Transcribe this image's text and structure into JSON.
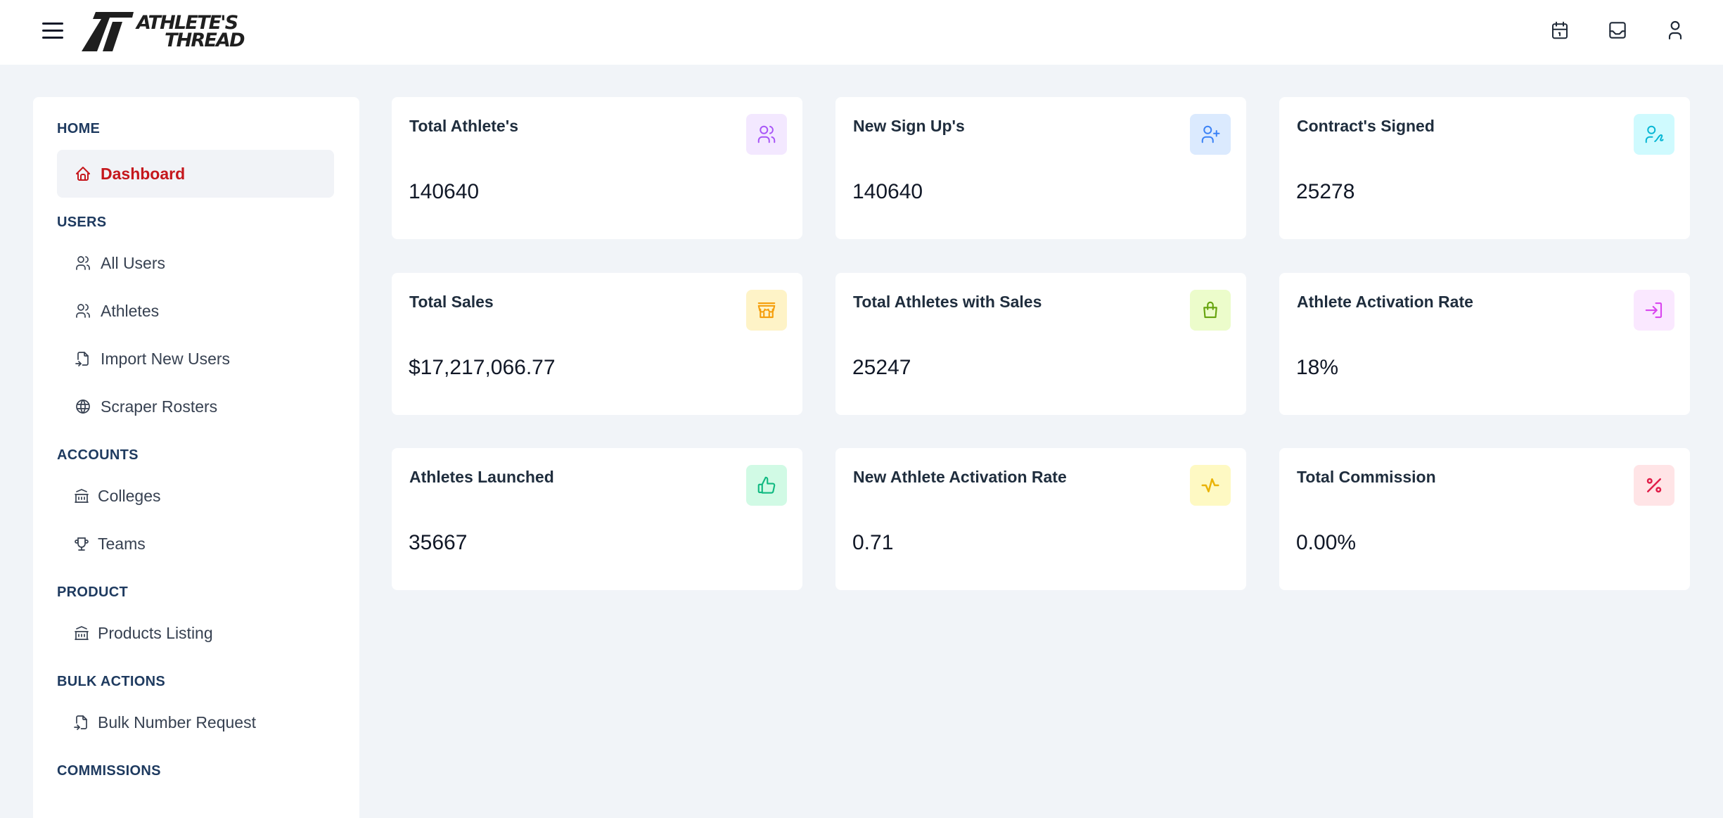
{
  "app": {
    "logo_line1": "ATHLETE'S",
    "logo_line2": "THREAD"
  },
  "header": {
    "icons": [
      "calendar-icon",
      "inbox-icon",
      "user-icon"
    ]
  },
  "sidebar": {
    "sections": {
      "home": "HOME",
      "users": "USERS",
      "accounts": "ACCOUNTS",
      "product": "PRODUCT",
      "bulk_actions": "BULK ACTIONS",
      "commissions": "COMMISSIONS"
    },
    "items": {
      "dashboard": "Dashboard",
      "all_users": "All Users",
      "athletes": "Athletes",
      "import_new_users": "Import New Users",
      "scraper_rosters": "Scraper Rosters",
      "colleges": "Colleges",
      "teams": "Teams",
      "products_listing": "Products Listing",
      "bulk_number_request": "Bulk Number Request"
    },
    "active_color": "#c5171c"
  },
  "cards": [
    {
      "title": "Total Athlete's",
      "value": "140640",
      "icon": "users-icon",
      "bg": "#f3e8ff",
      "fg": "#a855f7"
    },
    {
      "title": "New Sign Up's",
      "value": "140640",
      "icon": "user-plus-icon",
      "bg": "#dbeafe",
      "fg": "#3b82f6"
    },
    {
      "title": "Contract's Signed",
      "value": "25278",
      "icon": "user-signature-icon",
      "bg": "#cffafe",
      "fg": "#06b6d4"
    },
    {
      "title": "Total Sales",
      "value": "$17,217,066.77",
      "icon": "storefront-icon",
      "bg": "#fef3c7",
      "fg": "#f59e0b"
    },
    {
      "title": "Total Athletes with Sales",
      "value": "25247",
      "icon": "shopping-bag-icon",
      "bg": "#ecfccb",
      "fg": "#65a30d"
    },
    {
      "title": "Athlete Activation Rate",
      "value": "18%",
      "icon": "login-arrow-icon",
      "bg": "#fae8ff",
      "fg": "#d946ef"
    },
    {
      "title": "Athletes Launched",
      "value": "35667",
      "icon": "thumbs-up-icon",
      "bg": "#d1fae5",
      "fg": "#10b981"
    },
    {
      "title": "New Athlete Activation Rate",
      "value": "0.71",
      "icon": "activity-icon",
      "bg": "#fef9c3",
      "fg": "#eab308"
    },
    {
      "title": "Total Commission",
      "value": "0.00%",
      "icon": "percent-icon",
      "bg": "#ffe4e6",
      "fg": "#e11d48"
    }
  ]
}
